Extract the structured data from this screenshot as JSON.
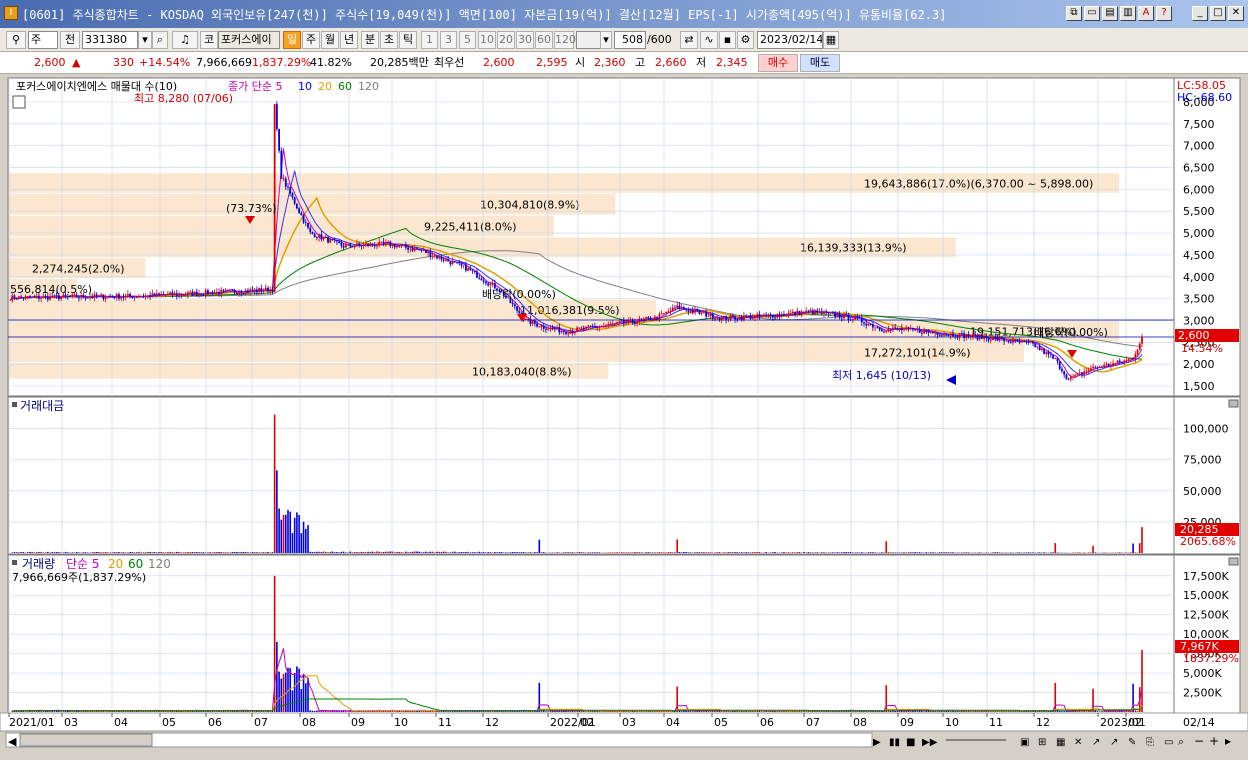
{
  "window": {
    "title": "[0601] 주식종합차트 - KOSDAQ 외국인보유[247(천)] 주식수[19,049(천)] 액면[100] 자본금[19(억)] 결산[12월] EPS[-1] 시가총액[495(억)] 유통비율[62.3]",
    "app_icon": "I"
  },
  "toolbar": {
    "mode": "주",
    "prev_label": "전",
    "code": "331380",
    "name": "포커스에이",
    "tab_label": "코",
    "periods": [
      "일",
      "주",
      "월",
      "년",
      "분",
      "초",
      "틱"
    ],
    "active_period": "일",
    "intervals": [
      "1",
      "3",
      "5",
      "10",
      "20",
      "30",
      "60",
      "120"
    ],
    "count": "508",
    "count_max": "/600",
    "date": "2023/02/14"
  },
  "quote": {
    "price": "2,600",
    "arrow": "▲",
    "change": "330",
    "change_pct": "+14.54%",
    "volume": "7,966,669",
    "volume_pct": "1,837.29%",
    "vol_ratio": "41.82%",
    "amount": "20,285백만",
    "best_label": "최우선",
    "ask": "2,600",
    "bid": "2,595",
    "open_label": "시",
    "open": "2,360",
    "high_label": "고",
    "high": "2,660",
    "low_label": "저",
    "low": "2,345",
    "buy_label": "매수",
    "sell_label": "매도"
  },
  "price_panel": {
    "legend_name": "포커스에이치엔에스 매물대 수(10)",
    "legend_ma": "종가 단순 5",
    "ma_periods": [
      "10",
      "20",
      "60",
      "120"
    ],
    "lc_label": "LC:58.05",
    "hc_label": "HC:-68.60",
    "y_ticks": [
      "8,000",
      "7,500",
      "7,000",
      "6,500",
      "6,000",
      "5,500",
      "5,000",
      "4,500",
      "4,000",
      "3,500",
      "3,000",
      "2,500",
      "2,000",
      "1,500"
    ],
    "last_price": "2,600",
    "last_pct": "14.54%",
    "max_label": "최고 8,280 (07/06)",
    "min_label": "최저 1,645 (10/13)",
    "gap_label": "(73.73%)",
    "div1": "배당락(0.00%)",
    "div2": "배당락(0.00%)",
    "volume_profile": [
      {
        "label": "19,643,886(17.0%)(6,370.00 ~ 5,898.00)",
        "price_low": 5898,
        "price_high": 6370,
        "share": 17.0
      },
      {
        "label": "10,304,810(8.9%)",
        "price_low": 5400,
        "price_high": 5898,
        "share": 8.9
      },
      {
        "label": "9,225,411(8.0%)",
        "price_low": 4900,
        "price_high": 5400,
        "share": 8.0
      },
      {
        "label": "16,139,333(13.9%)",
        "price_low": 4430,
        "price_high": 4900,
        "share": 13.9
      },
      {
        "label": "2,274,245(2.0%)",
        "price_low": 3950,
        "price_high": 4430,
        "share": 2.0
      },
      {
        "label": "556,814(0.5%)",
        "price_low": 3480,
        "price_high": 3950,
        "share": 0.5
      },
      {
        "label": "11,016,381(9.5%)",
        "price_low": 2990,
        "price_high": 3480,
        "share": 9.5
      },
      {
        "label": "19,151,713(16.6%)",
        "price_low": 2500,
        "price_high": 2990,
        "share": 16.6
      },
      {
        "label": "17,272,101(14.9%)",
        "price_low": 2030,
        "price_high": 2500,
        "share": 14.9
      },
      {
        "label": "10,183,040(8.8%)",
        "price_low": 1645,
        "price_high": 2030,
        "share": 8.8
      }
    ]
  },
  "amount_panel": {
    "title": "거래대금",
    "y_ticks": [
      "100,000",
      "75,000",
      "50,000",
      "25,000"
    ],
    "last_value": "20,285",
    "last_pct": "2065.68%"
  },
  "volume_panel": {
    "title": "거래량",
    "ma_label": "단순 5",
    "ma_periods": [
      "20",
      "60",
      "120"
    ],
    "summary": "7,966,669주(1,837.29%)",
    "y_ticks": [
      "17,500K",
      "15,000K",
      "12,500K",
      "10,000K",
      "7,500K",
      "5,000K",
      "2,500K"
    ],
    "last_value": "7,967K",
    "last_pct": "1837.29%"
  },
  "x_axis": {
    "labels": [
      "2021/01",
      "03",
      "04",
      "05",
      "06",
      "07",
      "08",
      "09",
      "10",
      "11",
      "12",
      "2022/01",
      "02",
      "03",
      "04",
      "05",
      "06",
      "07",
      "08",
      "09",
      "10",
      "11",
      "12",
      "2023/01",
      "02"
    ],
    "right_label": "02/14"
  },
  "colors": {
    "up": "#e00000",
    "down": "#0000e0",
    "ma5": "#c000c0",
    "ma10": "#0000ff",
    "ma20": "#e0a000",
    "ma60": "#008000",
    "ma120": "#808080",
    "profile": "#fbe7cf",
    "accent": "#f8a020"
  },
  "icons": [
    "question-icon",
    "minimize-icon",
    "maximize-icon",
    "close-icon",
    "search-icon",
    "speaker-icon",
    "save-icon",
    "gear-icon",
    "calendar-icon"
  ]
}
